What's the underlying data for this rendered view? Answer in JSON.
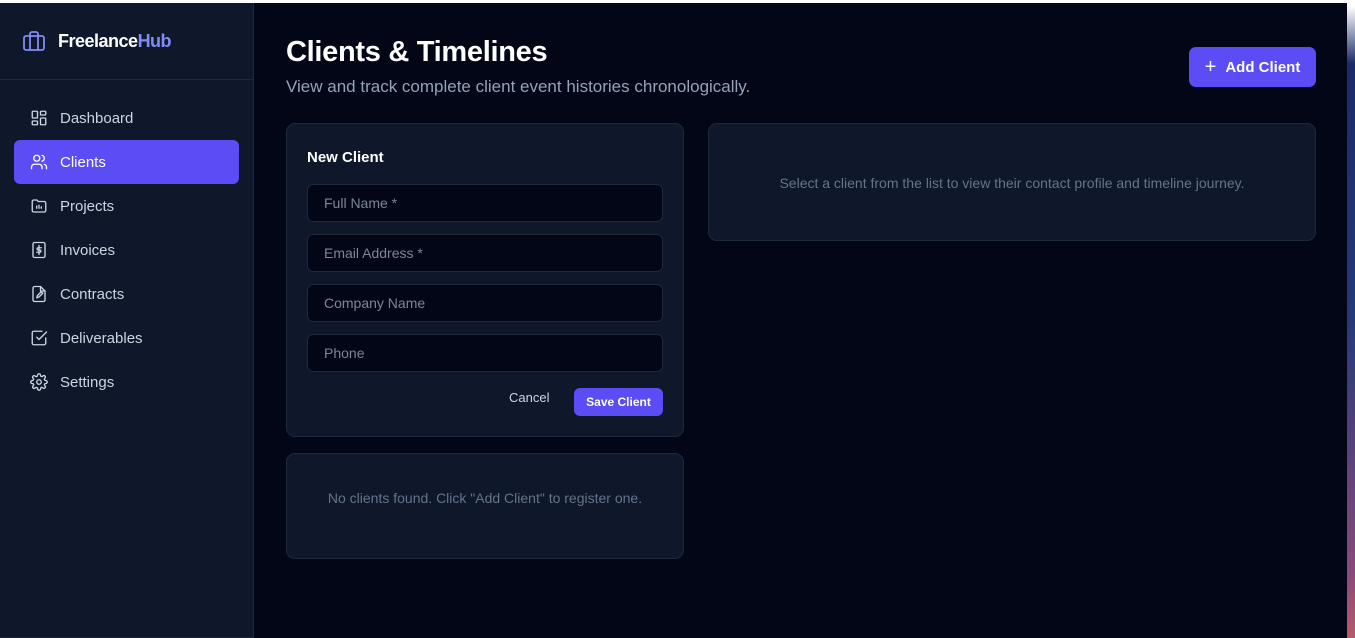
{
  "brand": {
    "name_part1": "Freelance",
    "name_part2": "Hub"
  },
  "sidebar": {
    "items": [
      {
        "label": "Dashboard",
        "icon": "dashboard-icon"
      },
      {
        "label": "Clients",
        "icon": "users-icon",
        "active": true
      },
      {
        "label": "Projects",
        "icon": "folder-icon"
      },
      {
        "label": "Invoices",
        "icon": "dollar-icon"
      },
      {
        "label": "Contracts",
        "icon": "edit-document-icon"
      },
      {
        "label": "Deliverables",
        "icon": "checkbox-icon"
      },
      {
        "label": "Settings",
        "icon": "gear-icon"
      }
    ]
  },
  "header": {
    "title": "Clients & Timelines",
    "subtitle": "View and track complete client event histories chronologically.",
    "add_button": "Add Client"
  },
  "new_client_form": {
    "title": "New Client",
    "fields": {
      "full_name": {
        "placeholder": "Full Name *",
        "value": ""
      },
      "email": {
        "placeholder": "Email Address *",
        "value": ""
      },
      "company": {
        "placeholder": "Company Name",
        "value": ""
      },
      "phone": {
        "placeholder": "Phone",
        "value": ""
      }
    },
    "cancel_label": "Cancel",
    "save_label": "Save Client"
  },
  "client_list": {
    "empty_message": "No clients found. Click \"Add Client\" to register one."
  },
  "detail_panel": {
    "placeholder": "Select a client from the list to view their contact profile and timeline journey."
  },
  "colors": {
    "accent": "#5b4cf5",
    "background": "#030616",
    "panel": "#0f172a",
    "brand_highlight": "#818cf8"
  }
}
